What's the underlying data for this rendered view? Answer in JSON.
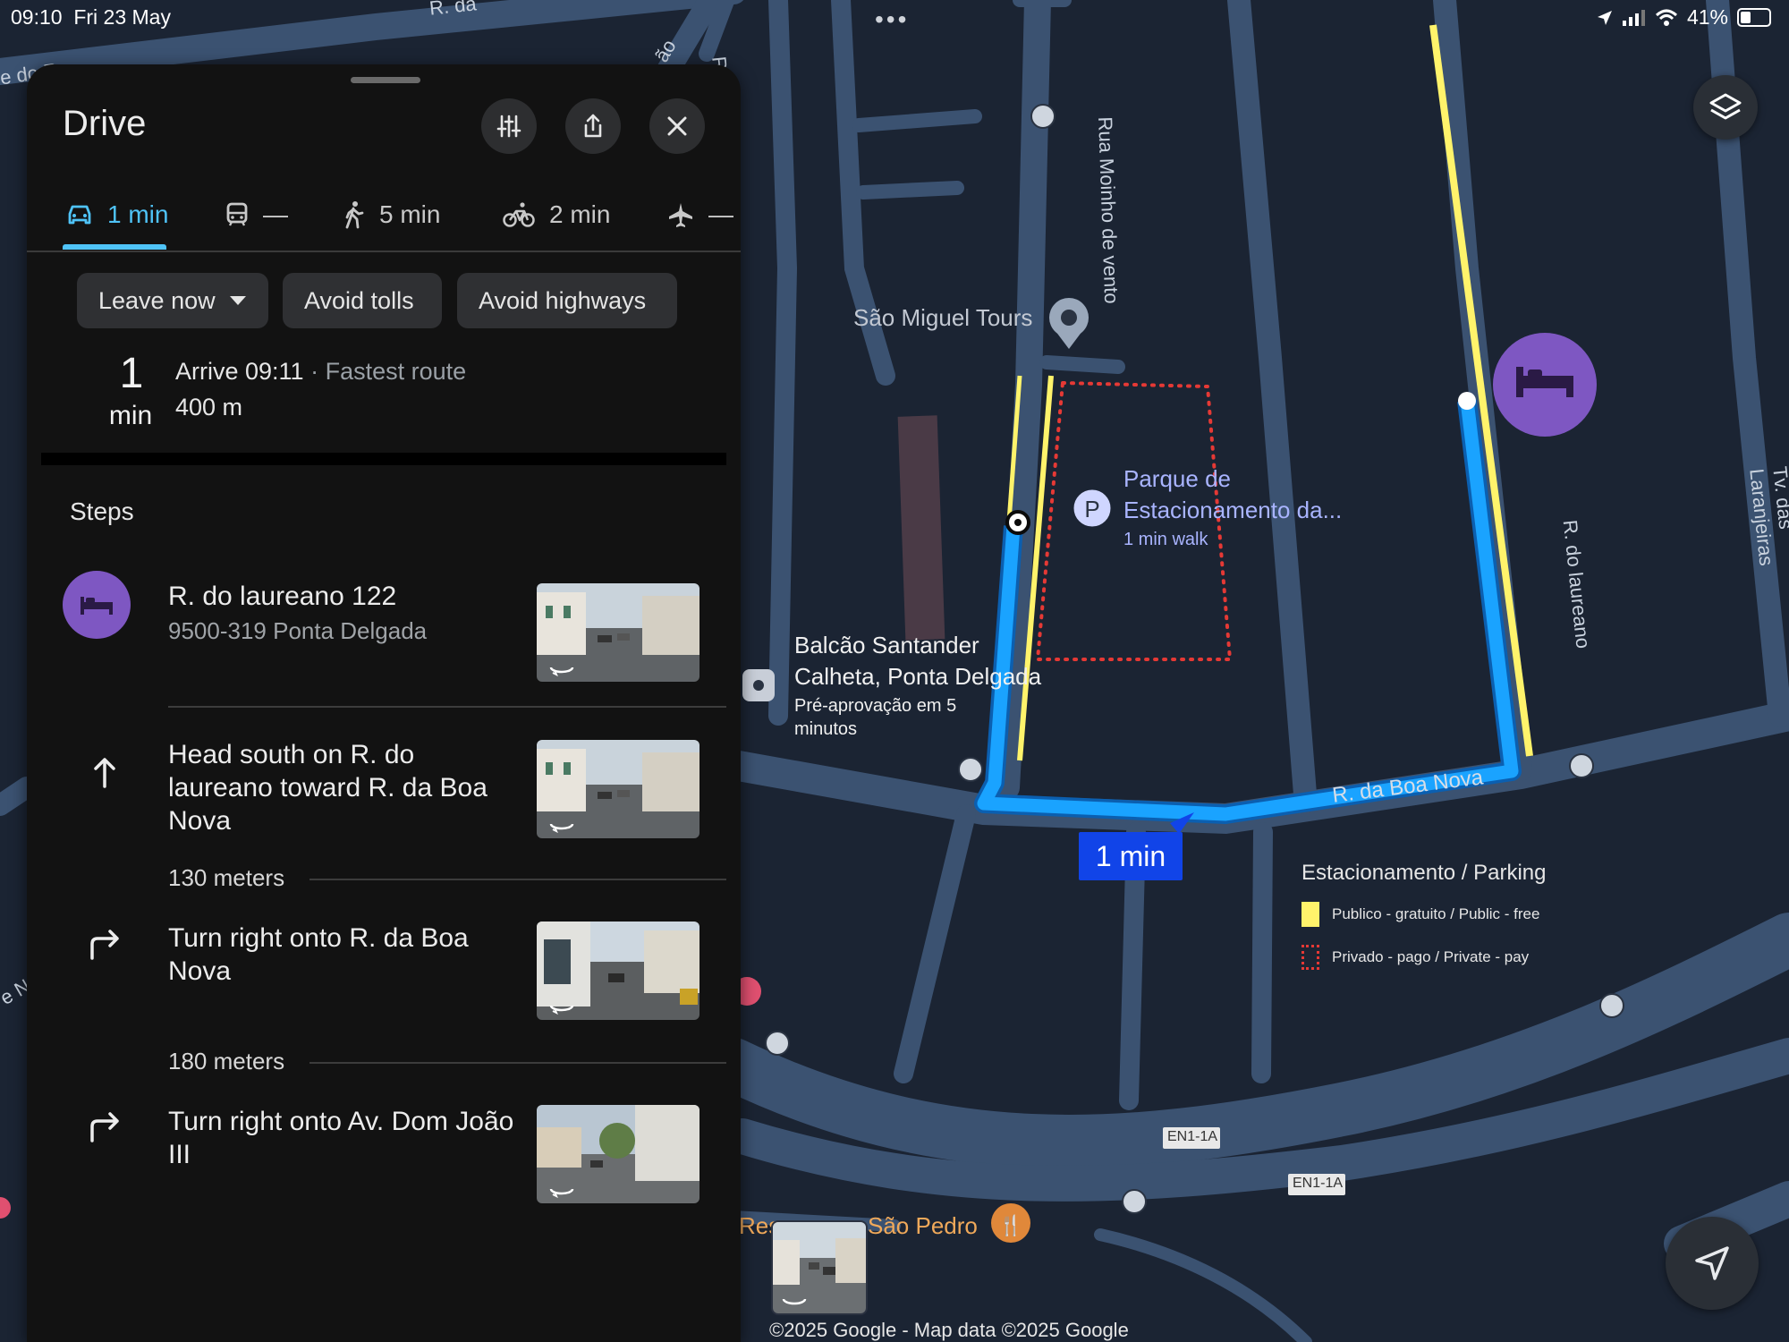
{
  "status_bar": {
    "time": "09:10",
    "date": "Fri 23 May",
    "more": "•••",
    "battery": "41%",
    "battery_level": 0.41
  },
  "panel": {
    "title": "Drive",
    "buttons": {
      "options_icon": "tune-icon",
      "share_icon": "share-icon",
      "close_icon": "close-icon"
    },
    "modes": [
      {
        "icon": "car-icon",
        "label": "1 min",
        "active": true
      },
      {
        "icon": "transit-icon",
        "label": "—"
      },
      {
        "icon": "walk-icon",
        "label": "5 min"
      },
      {
        "icon": "bike-icon",
        "label": "2 min"
      },
      {
        "icon": "flight-icon",
        "label": "—"
      }
    ],
    "chips": {
      "leave_now": "Leave now",
      "avoid_tolls": "Avoid tolls",
      "avoid_highways": "Avoid highways"
    },
    "summary": {
      "duration_value": "1",
      "duration_unit": "min",
      "arrive": "Arrive 09:11",
      "route_note": " · Fastest route",
      "distance": "400 m"
    },
    "steps_heading": "Steps",
    "origin": {
      "icon": "hotel-icon",
      "title": "R. do laureano 122",
      "address": "9500-319 Ponta Delgada"
    },
    "steps": [
      {
        "icon": "arrow-up-icon",
        "text": "Head south on R. do laureano toward R. da Boa Nova",
        "distance": "130 meters"
      },
      {
        "icon": "turn-right-icon",
        "text": "Turn right onto R. da Boa Nova",
        "distance": "180 meters"
      },
      {
        "icon": "turn-right-icon",
        "text": "Turn right onto Av. Dom João III"
      }
    ]
  },
  "map": {
    "streets": {
      "rua_moinho": "Rua Moinho de vento",
      "r_laureano": "R. do laureano",
      "tv_laranjeiras": "Tv. das Laranjeiras",
      "r_boa_nova": "R. da Boa Nova",
      "road_shield_1": "EN1-1A",
      "road_shield_2": "EN1-1A",
      "partial_top": "R. da ",
      "partial_left": "e do R",
      "partial_left2": "e N",
      "partial_top_right": "ão",
      "partial_r": "R"
    },
    "pois": {
      "sao_miguel_tours": "São Miguel Tours",
      "parking_title_1": "Parque de",
      "parking_title_2": "Estacionamento da...",
      "parking_sub": "1 min walk",
      "parking_icon": "P",
      "santander_1": "Balcão Santander",
      "santander_2": "Calheta, Ponta Delgada",
      "santander_3": "Pré-aprovação em 5",
      "santander_4": "minutos",
      "sao_pedro": "São Pedro",
      "res_partial": "Res"
    },
    "eta_label": "1 min",
    "legend": {
      "title": "Estacionamento / Parking",
      "public": "Publico - gratuito / Public - free",
      "private": "Privado - pago /  Private - pay"
    },
    "copyright": "©2025 Google - Map data ©2025 Google"
  },
  "colors": {
    "route": "#1aa3ff",
    "accent": "#4fc3f7",
    "hotel_purple": "#7e57c2",
    "parking_yellow": "#fff36b",
    "private_red": "#e53935",
    "map_bg": "#1b2433",
    "road": "#3d5575"
  }
}
